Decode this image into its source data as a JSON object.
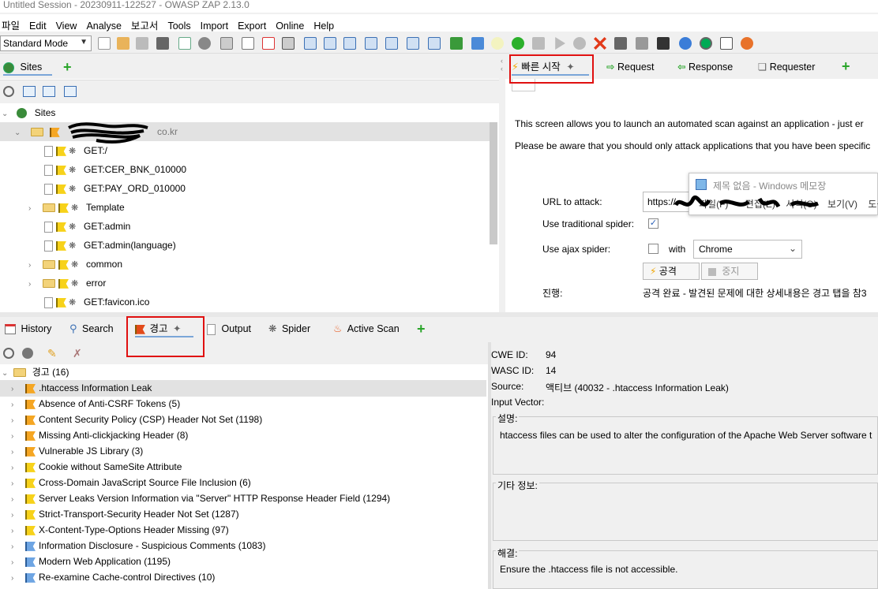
{
  "window": {
    "title": "Untitled Session - 20230911-122527 - OWASP ZAP 2.13.0"
  },
  "menu": [
    "파일",
    "Edit",
    "View",
    "Analyse",
    "보고서",
    "Tools",
    "Import",
    "Export",
    "Online",
    "Help"
  ],
  "toolbar": {
    "mode": "Standard Mode"
  },
  "sites_panel": {
    "tab_label": "Sites",
    "root_label": "Sites",
    "host_label": "co.kr",
    "nodes": [
      {
        "label": "GET:/",
        "type": "file"
      },
      {
        "label": "GET:CER_BNK_010000",
        "type": "file"
      },
      {
        "label": "GET:PAY_ORD_010000",
        "type": "file"
      },
      {
        "label": "Template",
        "type": "folder"
      },
      {
        "label": "GET:admin",
        "type": "file"
      },
      {
        "label": "GET:admin(language)",
        "type": "file"
      },
      {
        "label": "common",
        "type": "folder"
      },
      {
        "label": "error",
        "type": "folder"
      },
      {
        "label": "GET:favicon.ico",
        "type": "file"
      }
    ]
  },
  "workspace": {
    "tabs": [
      "빠른 시작",
      "Request",
      "Response",
      "Requester"
    ],
    "intro_line1": "This screen allows you to launch an automated scan against  an application - just er",
    "intro_line2": "Please be aware that you should only attack applications that you have been specific",
    "url_label": "URL to attack:",
    "url_value": "https://",
    "traditional_spider_label": "Use traditional spider:",
    "ajax_spider_label": "Use ajax spider:",
    "with_label": "with",
    "browser": "Chrome",
    "attack_button": "공격",
    "stop_button": "중지",
    "progress_label": "진행:",
    "progress_value": "공격 완료 - 발견된 문제에 대한 상세내용은 경고 탭을 참3"
  },
  "notepad": {
    "title": "제목 없음 - Windows 메모장",
    "menu_partial": [
      "파일(F)",
      "편집(E)",
      "서식(O)",
      "보기(V)",
      "도움"
    ]
  },
  "bottom_tabs": [
    "History",
    "Search",
    "경고",
    "Output",
    "Spider",
    "Active Scan"
  ],
  "alerts": {
    "root_label": "경고 (16)",
    "items": [
      {
        "label": ".htaccess Information Leak",
        "risk": "orange"
      },
      {
        "label": "Absence of Anti-CSRF Tokens (5)",
        "risk": "orange"
      },
      {
        "label": "Content Security Policy (CSP) Header Not Set (1198)",
        "risk": "orange"
      },
      {
        "label": "Missing Anti-clickjacking Header (8)",
        "risk": "orange"
      },
      {
        "label": "Vulnerable JS Library (3)",
        "risk": "orange"
      },
      {
        "label": "Cookie without SameSite Attribute",
        "risk": "yellow"
      },
      {
        "label": "Cross-Domain JavaScript Source File Inclusion (6)",
        "risk": "yellow"
      },
      {
        "label": "Server Leaks Version Information via \"Server\" HTTP Response Header Field (1294)",
        "risk": "yellow"
      },
      {
        "label": "Strict-Transport-Security Header Not Set (1287)",
        "risk": "yellow"
      },
      {
        "label": "X-Content-Type-Options Header Missing (97)",
        "risk": "yellow"
      },
      {
        "label": "Information Disclosure - Suspicious Comments (1083)",
        "risk": "blue"
      },
      {
        "label": "Modern Web Application (1195)",
        "risk": "blue"
      },
      {
        "label": "Re-examine Cache-control Directives (10)",
        "risk": "blue"
      }
    ]
  },
  "alert_detail": {
    "cwe_label": "CWE ID:",
    "cwe_value": "94",
    "wasc_label": "WASC ID:",
    "wasc_value": "14",
    "source_label": "Source:",
    "source_value": "액티브 (40032 - .htaccess Information Leak)",
    "input_vector_label": "Input Vector:",
    "description_label": "설명:",
    "description_text": "htaccess files can be used to alter the configuration of the Apache Web Server software t",
    "other_label": "기타 정보:",
    "solution_label": "해결:",
    "solution_text": "Ensure the .htaccess file is not accessible."
  }
}
